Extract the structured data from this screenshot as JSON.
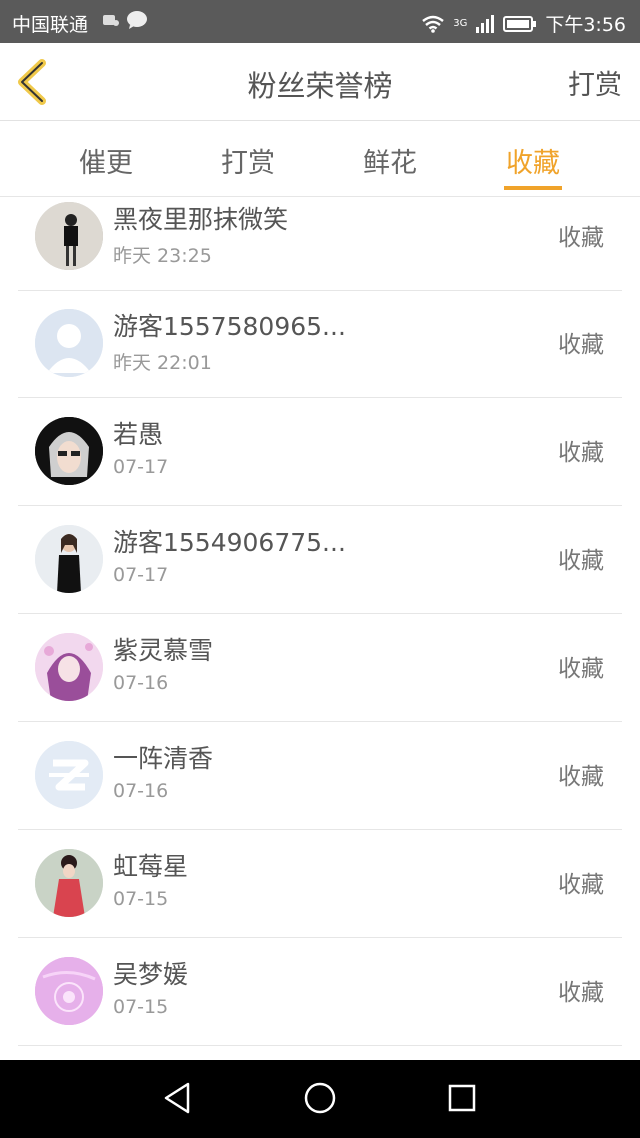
{
  "status_bar": {
    "carrier": "中国联通",
    "network": "3G",
    "time": "下午3:56"
  },
  "header": {
    "title": "粉丝荣誉榜",
    "right_action": "打赏",
    "back_icon": "chevron-left-icon",
    "accent_color": "#f0a32a"
  },
  "tabs": [
    {
      "label": "催更",
      "active": false
    },
    {
      "label": "打赏",
      "active": false
    },
    {
      "label": "鲜花",
      "active": false
    },
    {
      "label": "收藏",
      "active": true
    }
  ],
  "items": [
    {
      "name": "黑夜里那抹微笑",
      "time": "昨天 23:25",
      "action": "收藏"
    },
    {
      "name": "游客1557580965...",
      "time": "昨天 22:01",
      "action": "收藏"
    },
    {
      "name": "若愚",
      "time": "07-17",
      "action": "收藏"
    },
    {
      "name": "游客1554906775...",
      "time": "07-17",
      "action": "收藏"
    },
    {
      "name": "紫灵慕雪",
      "time": "07-16",
      "action": "收藏"
    },
    {
      "name": "一阵清香",
      "time": "07-16",
      "action": "收藏"
    },
    {
      "name": "虹莓星",
      "time": "07-15",
      "action": "收藏"
    },
    {
      "name": "吴梦媛",
      "time": "07-15",
      "action": "收藏"
    }
  ]
}
